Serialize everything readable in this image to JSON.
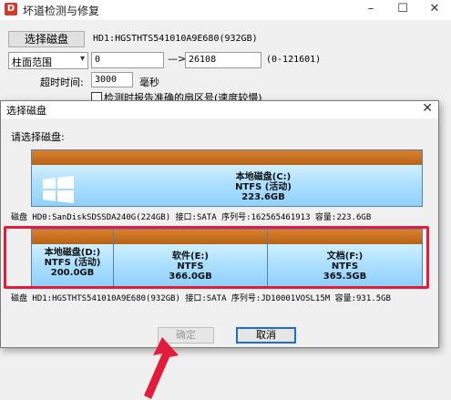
{
  "background_window": {
    "title": "坏道检测与修复",
    "app_icon": "D",
    "select_disk_button": "选择磁盘",
    "disk_label": "HD1:HGSTHTS541010A9E680(932GB)",
    "range_select": "柱面范围",
    "start_value": "0",
    "arrow": "—>",
    "end_value": "26108",
    "range_hint": "(0-121601)",
    "timeout_label": "超时时间:",
    "timeout_value": "3000",
    "timeout_unit": "毫秒",
    "report_checkbox_label": "检测时报告准确的扇区号(速度较慢)"
  },
  "dialog": {
    "title": "选择磁盘",
    "prompt": "请选择磁盘:",
    "disks": [
      {
        "partitions": [
          {
            "name": "本地磁盘(C:)",
            "fs": "NTFS (活动)",
            "size": "223.6GB"
          }
        ],
        "info": "磁盘 HD0:SanDiskSDSSDA240G(224GB)   接口:SATA  序列号:162565461913  容量:223.6GB"
      },
      {
        "partitions": [
          {
            "name": "本地磁盘(D:)",
            "fs": "NTFS (活动)",
            "size": "200.0GB"
          },
          {
            "name": "软件(E:)",
            "fs": "NTFS",
            "size": "366.0GB"
          },
          {
            "name": "文档(F:)",
            "fs": "NTFS",
            "size": "365.5GB"
          }
        ],
        "info": "磁盘 HD1:HGSTHTS541010A9E680(932GB)    接口:SATA  序列号:JD10001VOSL15M  容量:931.5GB"
      }
    ],
    "ok_button": "确定",
    "cancel_button": "取消"
  },
  "colors": {
    "highlight": "#e21d3c",
    "partition_cap": "#d9802a",
    "partition_body": "#aee0ff",
    "annotation_arrow": "#e21d3c"
  },
  "icons": [
    "app-icon",
    "windows-logo-icon",
    "close-icon",
    "minimize-icon",
    "maximize-icon",
    "dropdown-chevron-icon"
  ]
}
